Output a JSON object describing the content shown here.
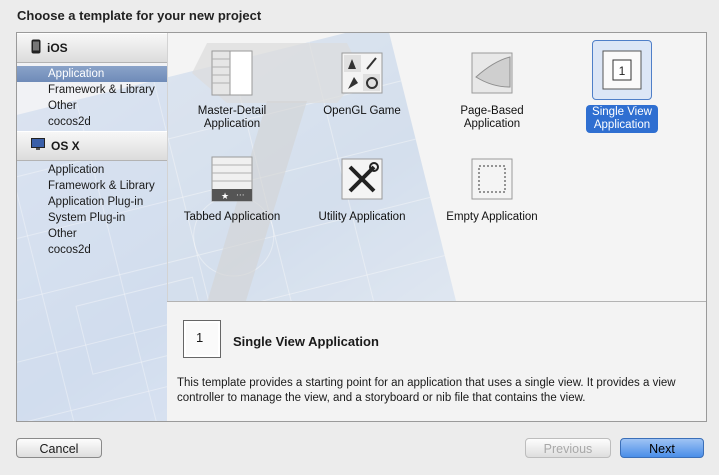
{
  "dialog": {
    "title": "Choose a template for your new project"
  },
  "sidebar": {
    "sections": [
      {
        "name": "iOS",
        "icon": "iphone-icon",
        "items": [
          "Application",
          "Framework & Library",
          "Other",
          "cocos2d"
        ]
      },
      {
        "name": "OS X",
        "icon": "mac-icon",
        "items": [
          "Application",
          "Framework & Library",
          "Application Plug-in",
          "System Plug-in",
          "Other",
          "cocos2d"
        ]
      }
    ],
    "selected": "iOS / Application"
  },
  "templates": [
    {
      "label1": "Master-Detail",
      "label2": "Application",
      "icon": "master-detail-icon"
    },
    {
      "label1": "OpenGL Game",
      "label2": "",
      "icon": "opengl-game-icon"
    },
    {
      "label1": "Page-Based",
      "label2": "Application",
      "icon": "page-based-icon"
    },
    {
      "label1": "Single View",
      "label2": "Application",
      "icon": "single-view-icon",
      "selected": true
    },
    {
      "label1": "Tabbed Application",
      "label2": "",
      "icon": "tabbed-icon"
    },
    {
      "label1": "Utility Application",
      "label2": "",
      "icon": "utility-icon"
    },
    {
      "label1": "Empty Application",
      "label2": "",
      "icon": "empty-app-icon"
    }
  ],
  "description": {
    "title": "Single View Application",
    "icon_text": "1",
    "text": "This template provides a starting point for an application that uses a single view. It provides a view controller to manage the view, and a storyboard or nib file that contains the view."
  },
  "buttons": {
    "cancel": "Cancel",
    "previous": "Previous",
    "next": "Next"
  },
  "colors": {
    "selection": "#2f6fd1",
    "sidebar_selection": "#7b95bf"
  }
}
